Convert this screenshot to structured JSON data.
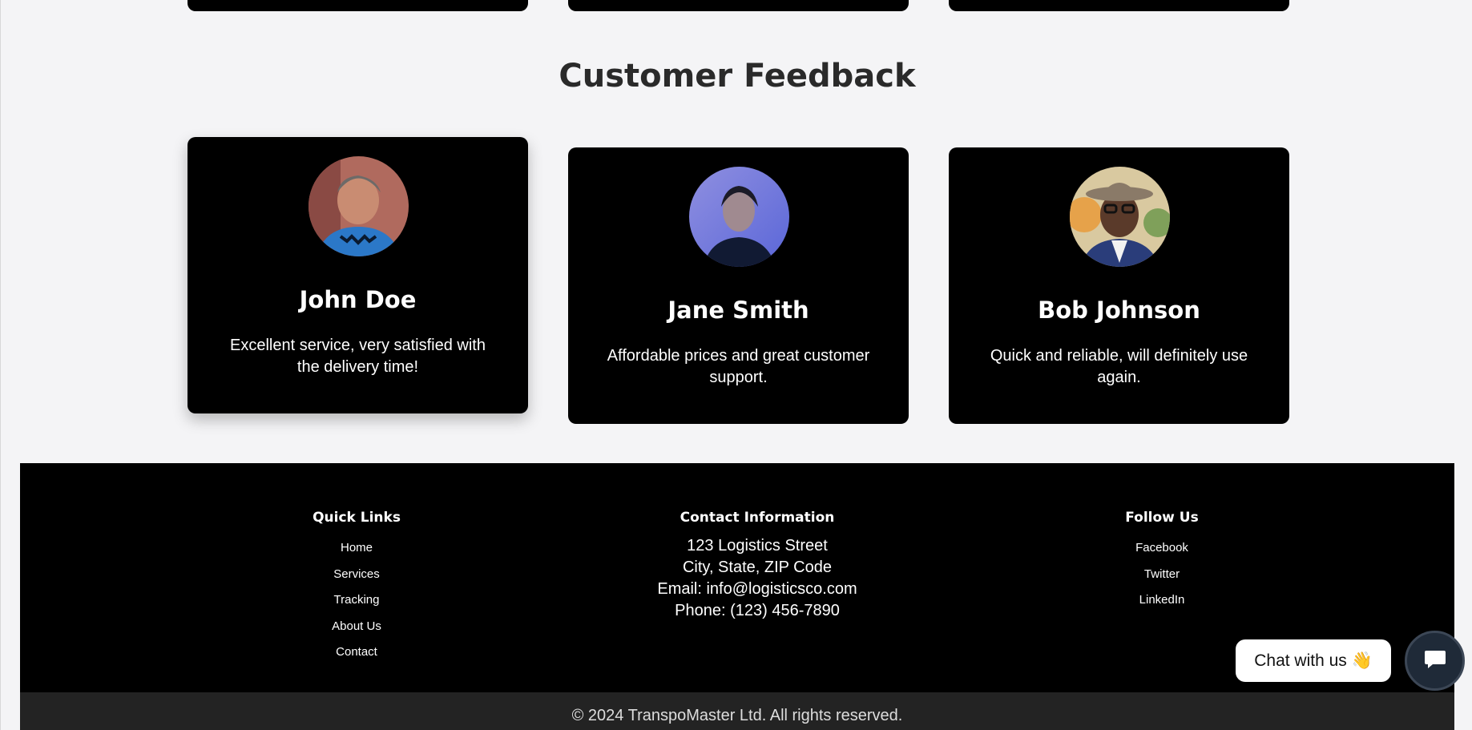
{
  "feedback": {
    "title": "Customer Feedback",
    "testimonials": [
      {
        "name": "John Doe",
        "text": "Excellent service, very satisfied with the delivery time!"
      },
      {
        "name": "Jane Smith",
        "text": "Affordable prices and great customer support."
      },
      {
        "name": "Bob Johnson",
        "text": "Quick and reliable, will definitely use again."
      }
    ]
  },
  "footer": {
    "quick_links": {
      "heading": "Quick Links",
      "items": [
        "Home",
        "Services",
        "Tracking",
        "About Us",
        "Contact"
      ]
    },
    "contact": {
      "heading": "Contact Information",
      "lines": [
        "123 Logistics Street",
        "City, State, ZIP Code",
        "Email: info@logisticsco.com",
        "Phone: (123) 456-7890"
      ]
    },
    "follow": {
      "heading": "Follow Us",
      "items": [
        "Facebook",
        "Twitter",
        "LinkedIn"
      ]
    },
    "copyright": "© 2024 TranspoMaster Ltd. All rights reserved."
  },
  "chat": {
    "label": "Chat with us 👋",
    "icon": "chat-icon"
  }
}
